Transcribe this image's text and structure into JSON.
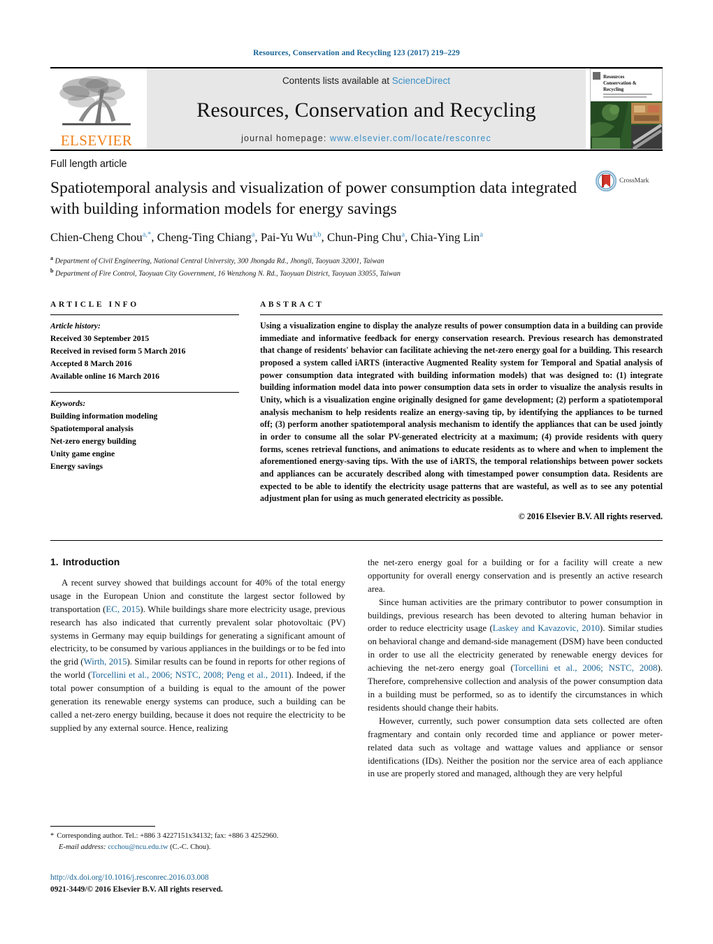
{
  "running_head": "Resources, Conservation and Recycling 123 (2017) 219–229",
  "masthead": {
    "publisher_name": "ELSEVIER",
    "contents_prefix": "Contents lists available at ",
    "contents_link": "ScienceDirect",
    "journal_title": "Resources, Conservation and Recycling",
    "homepage_prefix": "journal homepage: ",
    "homepage_url": "www.elsevier.com/locate/resconrec",
    "cover_title_line1": "Resources",
    "cover_title_line2": "Conservation &",
    "cover_title_line3": "Recycling"
  },
  "article": {
    "type": "Full length article",
    "title": "Spatiotemporal analysis and visualization of power consumption data integrated with building information models for energy savings",
    "authors_html": "Chien-Cheng Chou<sup>a,</sup><sup>*</sup>, Cheng-Ting Chiang<sup>a</sup>, Pai-Yu Wu<sup>a,b</sup>, Chun-Ping Chu<sup>a</sup>, Chia-Ying Lin<sup>a</sup>",
    "affiliation_a": "Department of Civil Engineering, National Central University, 300 Jhongda Rd., Jhongli, Taoyuan 32001, Taiwan",
    "affiliation_b": "Department of Fire Control, Taoyuan City Government, 16 Wenzhong N. Rd., Taoyuan District, Taoyuan 33055, Taiwan",
    "crossmark_label": "CrossMark"
  },
  "article_info": {
    "heading": "ARTICLE INFO",
    "history_label": "Article history:",
    "history_items": [
      "Received 30 September 2015",
      "Received in revised form 5 March 2016",
      "Accepted 8 March 2016",
      "Available online 16 March 2016"
    ],
    "keywords_label": "Keywords:",
    "keywords": [
      "Building information modeling",
      "Spatiotemporal analysis",
      "Net-zero energy building",
      "Unity game engine",
      "Energy savings"
    ]
  },
  "abstract": {
    "heading": "ABSTRACT",
    "text": "Using a visualization engine to display the analyze results of power consumption data in a building can provide immediate and informative feedback for energy conservation research. Previous research has demonstrated that change of residents' behavior can facilitate achieving the net-zero energy goal for a building. This research proposed a system called iARTS (interactive Augmented Reality system for Temporal and Spatial analysis of power consumption data integrated with building information models) that was designed to: (1) integrate building information model data into power consumption data sets in order to visualize the analysis results in Unity, which is a visualization engine originally designed for game development; (2) perform a spatiotemporal analysis mechanism to help residents realize an energy-saving tip, by identifying the appliances to be turned off; (3) perform another spatiotemporal analysis mechanism to identify the appliances that can be used jointly in order to consume all the solar PV-generated electricity at a maximum; (4) provide residents with query forms, scenes retrieval functions, and animations to educate residents as to where and when to implement the aforementioned energy-saving tips. With the use of iARTS, the temporal relationships between power sockets and appliances can be accurately described along with timestamped power consumption data. Residents are expected to be able to identify the electricity usage patterns that are wasteful, as well as to see any potential adjustment plan for using as much generated electricity as possible.",
    "copyright": "© 2016 Elsevier B.V. All rights reserved."
  },
  "introduction": {
    "section_number": "1.",
    "section_title": "Introduction",
    "left_para1_parts": {
      "a": "A recent survey showed that buildings account for 40% of the total energy usage in the European Union and constitute the largest sector followed by transportation (",
      "ref1": "EC, 2015",
      "b": "). While buildings share more electricity usage, previous research has also indicated that currently prevalent solar photovoltaic (PV) systems in Germany may equip buildings for generating a significant amount of electricity, to be consumed by various appliances in the buildings or to be fed into the grid (",
      "ref2": "Wirth, 2015",
      "c": "). Similar results can be found in reports for other regions of the world (",
      "ref3": "Torcellini et al., 2006; NSTC, 2008; Peng et al., 2011",
      "d": "). Indeed, if the total power consumption of a building is equal to the amount of the power generation its renewable energy systems can produce, such a building can be called a net-zero energy building, because it does not require the electricity to be supplied by any external source. Hence, realizing"
    },
    "right_para1_cont": "the net-zero energy goal for a building or for a facility will create a new opportunity for overall energy conservation and is presently an active research area.",
    "right_para2_parts": {
      "a": "Since human activities are the primary contributor to power consumption in buildings, previous research has been devoted to altering human behavior in order to reduce electricity usage (",
      "ref1": "Laskey and Kavazovic, 2010",
      "b": "). Similar studies on behavioral change and demand-side management (DSM) have been conducted in order to use all the electricity generated by renewable energy devices for achieving the net-zero energy goal (",
      "ref2": "Torcellini et al., 2006; NSTC, 2008",
      "c": "). Therefore, comprehensive collection and analysis of the power consumption data in a building must be performed, so as to identify the circumstances in which residents should change their habits."
    },
    "right_para3": "However, currently, such power consumption data sets collected are often fragmentary and contain only recorded time and appliance or power meter-related data such as voltage and wattage values and appliance or sensor identifications (IDs). Neither the position nor the service area of each appliance in use are properly stored and managed, although they are very helpful"
  },
  "footnote": {
    "star": "*",
    "corresponding": "Corresponding author. Tel.: +886 3 4227151x34132; fax: +886 3 4252960.",
    "email_label": "E-mail address:",
    "email": "ccchou@ncu.edu.tw",
    "email_suffix": "(C.-C. Chou)."
  },
  "publication_footer": {
    "doi": "http://dx.doi.org/10.1016/j.resconrec.2016.03.008",
    "issn_line": "0921-3449/© 2016 Elsevier B.V. All rights reserved."
  },
  "colors": {
    "link_blue": "#1a6496",
    "sciencedirect_blue": "#3a8fc4",
    "elsevier_orange": "#f0811a",
    "masthead_gray": "#e7e7e8"
  }
}
